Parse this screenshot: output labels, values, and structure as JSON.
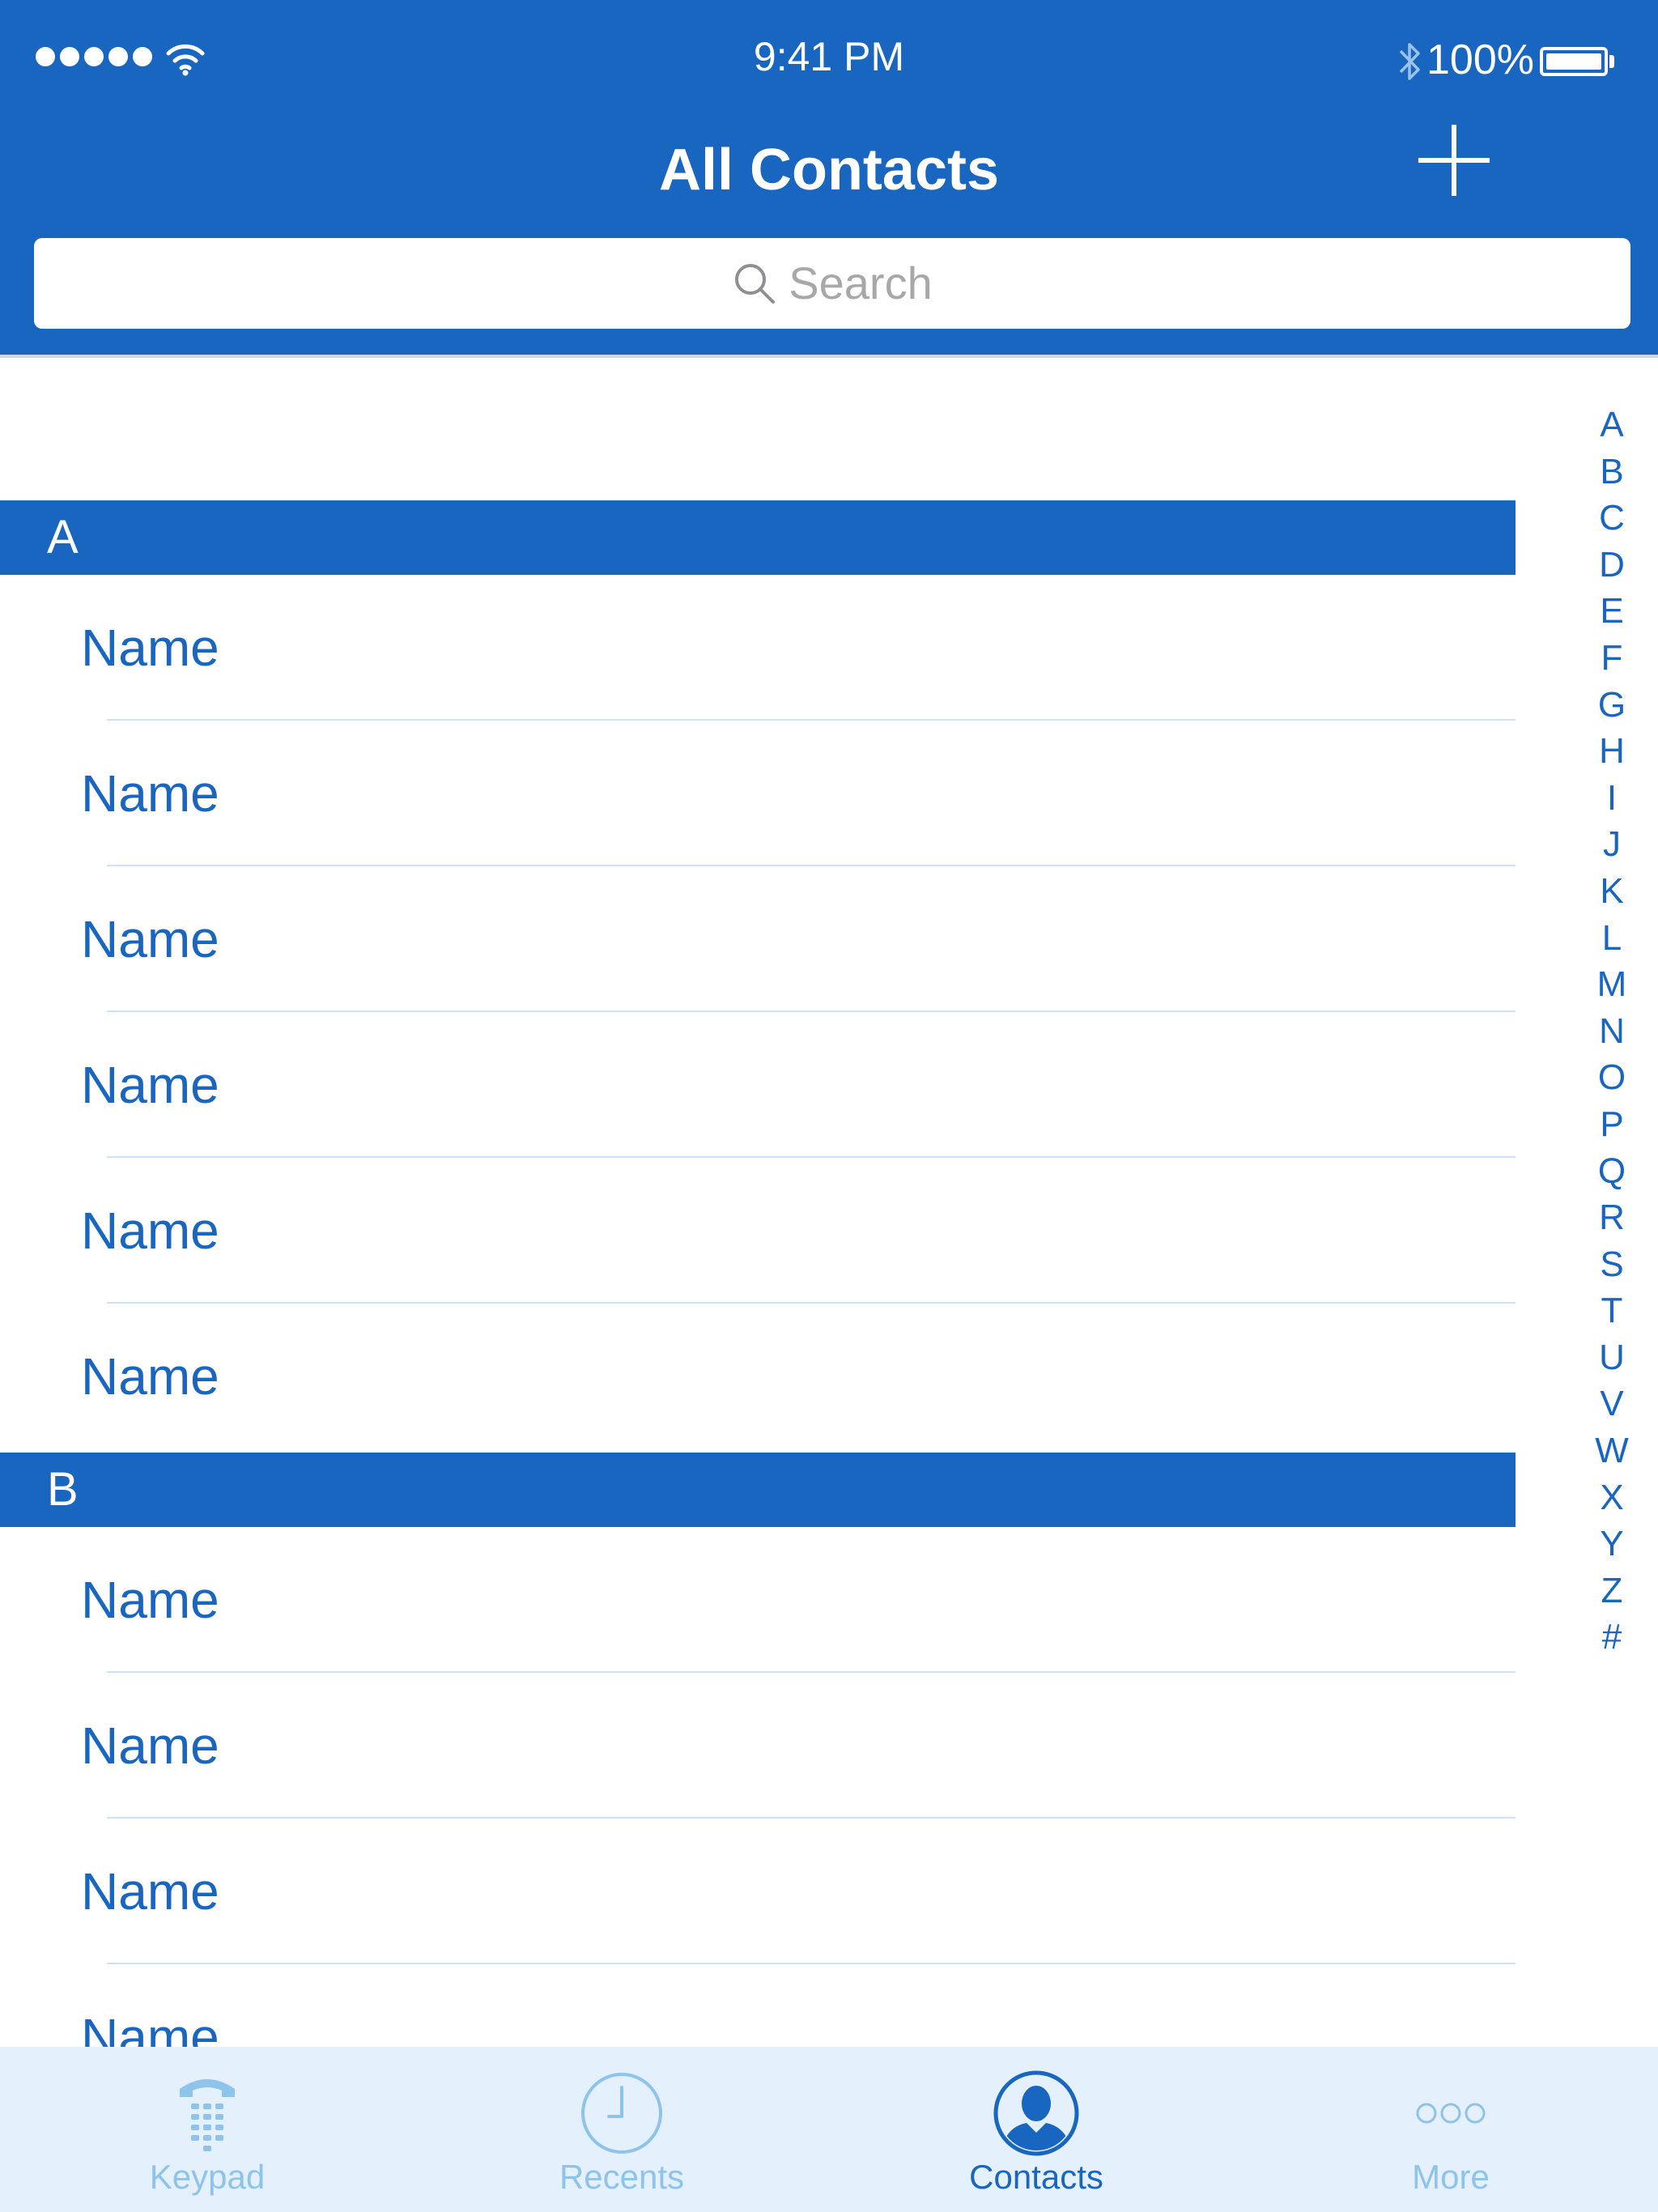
{
  "status_bar": {
    "time": "9:41 PM",
    "battery": "100%"
  },
  "nav": {
    "title": "All Contacts",
    "add_icon": "plus-icon"
  },
  "search": {
    "placeholder": "Search",
    "icon": "magnifier-icon"
  },
  "sections": [
    {
      "letter": "A",
      "rows": [
        "Name",
        "Name",
        "Name",
        "Name",
        "Name",
        "Name"
      ]
    },
    {
      "letter": "B",
      "rows": [
        "Name",
        "Name",
        "Name",
        "Name"
      ]
    }
  ],
  "index": [
    "A",
    "B",
    "C",
    "D",
    "E",
    "F",
    "G",
    "H",
    "I",
    "J",
    "K",
    "L",
    "M",
    "N",
    "O",
    "P",
    "Q",
    "R",
    "S",
    "T",
    "U",
    "V",
    "W",
    "X",
    "Y",
    "Z",
    "#"
  ],
  "tabs": [
    {
      "label": "Keypad",
      "icon": "telephone-keypad-icon"
    },
    {
      "label": "Recents",
      "icon": "clock-icon"
    },
    {
      "label": "Contacts",
      "icon": "person-icon",
      "active": true
    },
    {
      "label": "More",
      "icon": "more-icon"
    }
  ],
  "colors": {
    "accent": "#1966c0",
    "tab_inactive": "#8ec3ec",
    "tab_bar_bg": "#e4f0fb",
    "row_divider": "#cfe1f3"
  }
}
